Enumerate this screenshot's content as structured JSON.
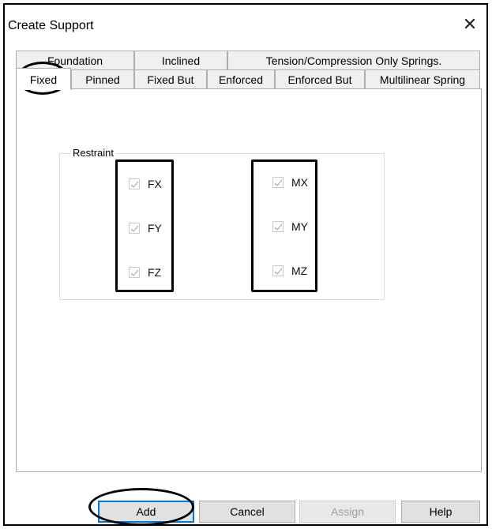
{
  "dialog": {
    "title": "Create Support"
  },
  "tabs": {
    "back_row": [
      "Foundation",
      "Inclined",
      "Tension/Compression Only Springs."
    ],
    "front_row": [
      "Fixed",
      "Pinned",
      "Fixed But",
      "Enforced",
      "Enforced But",
      "Multilinear Spring"
    ],
    "active": "Fixed"
  },
  "restraint": {
    "label": "Restraint",
    "forces": [
      {
        "label": "FX",
        "checked": true
      },
      {
        "label": "FY",
        "checked": true
      },
      {
        "label": "FZ",
        "checked": true
      }
    ],
    "moments": [
      {
        "label": "MX",
        "checked": true
      },
      {
        "label": "MY",
        "checked": true
      },
      {
        "label": "MZ",
        "checked": true
      }
    ]
  },
  "buttons": {
    "add": "Add",
    "cancel": "Cancel",
    "assign": "Assign",
    "help": "Help"
  },
  "icons": {
    "close": "close-icon",
    "check": "checkmark-icon"
  },
  "colors": {
    "default_button_border": "#0078d7",
    "disabled_text": "#a0a0a0",
    "annotation": "#000000"
  }
}
